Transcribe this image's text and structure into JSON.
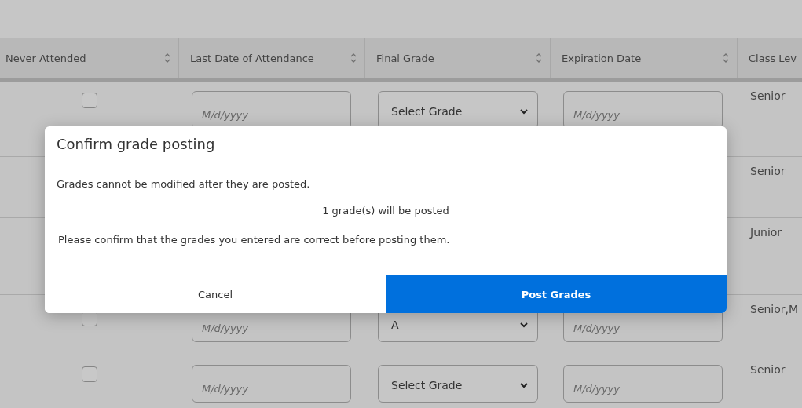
{
  "table": {
    "columns": [
      {
        "label": "Never Attended",
        "sortable": true
      },
      {
        "label": "Last Date of Attendance",
        "sortable": true
      },
      {
        "label": "Final Grade",
        "sortable": true
      },
      {
        "label": "Expiration Date",
        "sortable": true
      },
      {
        "label": "Class Lev",
        "sortable": false
      }
    ],
    "rows": [
      {
        "never_attended": {
          "checked": false
        },
        "last_date": {
          "placeholder": "M/d/yyyy"
        },
        "final_grade": {
          "value": "Select Grade"
        },
        "expiration_date": {
          "placeholder": "M/d/yyyy"
        },
        "class_level": "Senior"
      },
      {
        "class_level": "Senior"
      },
      {
        "class_level": "Junior"
      },
      {
        "never_attended": {
          "checked": false
        },
        "last_date": {
          "placeholder": "M/d/yyyy"
        },
        "final_grade": {
          "value": "A"
        },
        "expiration_date": {
          "placeholder": "M/d/yyyy"
        },
        "class_level": "Senior,M"
      },
      {
        "never_attended": {
          "checked": false
        },
        "last_date": {
          "placeholder": "M/d/yyyy"
        },
        "final_grade": {
          "value": "Select Grade"
        },
        "expiration_date": {
          "placeholder": "M/d/yyyy"
        },
        "class_level": "Senior"
      }
    ]
  },
  "dialog": {
    "title": "Confirm grade posting",
    "warning": "Grades cannot be modified after they are posted.",
    "count": "1 grade(s) will be posted",
    "instruction": "Please confirm that the grades you entered are correct before posting them.",
    "buttons": [
      {
        "label": "Cancel",
        "kind": "secondary"
      },
      {
        "label": "Post Grades",
        "kind": "primary"
      }
    ]
  }
}
